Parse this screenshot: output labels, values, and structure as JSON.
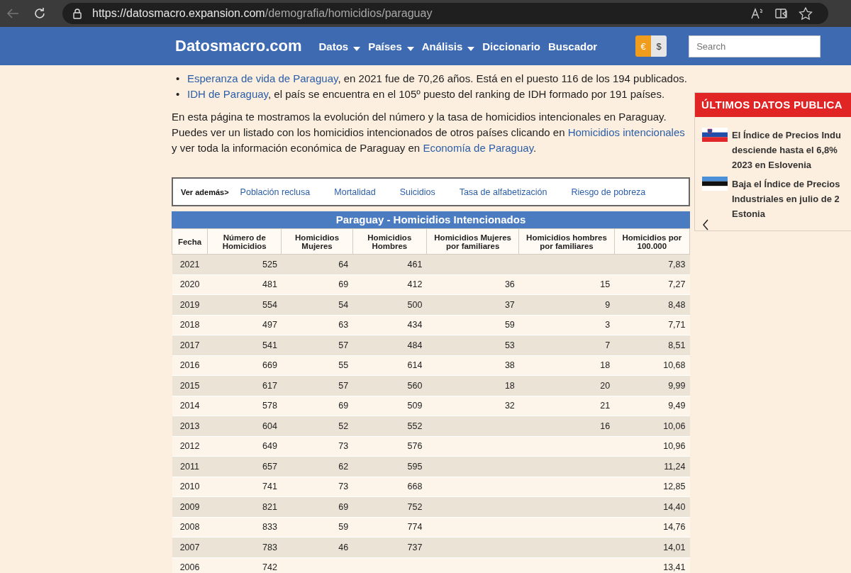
{
  "browser": {
    "url_host": "https://datosmacro.expansion.com",
    "url_path": "/demografia/homicidios/paraguay"
  },
  "header": {
    "logo": "Datosmacro.com",
    "nav": [
      {
        "label": "Datos",
        "dropdown": true
      },
      {
        "label": "Países",
        "dropdown": true
      },
      {
        "label": "Análisis",
        "dropdown": true
      },
      {
        "label": "Diccionario",
        "dropdown": false
      },
      {
        "label": "Buscador",
        "dropdown": false
      }
    ],
    "currency": [
      {
        "label": "€",
        "selected": true
      },
      {
        "label": "$",
        "selected": false
      }
    ],
    "search": {
      "placeholder": "Search"
    }
  },
  "bullets": [
    {
      "marker": "•",
      "link": "Esperanza de vida de Paraguay",
      "text": ", en 2021 fue de 70,26 años. Está en el puesto 116 de los 194 publicados."
    },
    {
      "marker": "•",
      "link": "IDH de Paraguay",
      "text": ", el país se encuentra en el 105º puesto del ranking de IDH formado por 191 países."
    }
  ],
  "intro": {
    "text1": "En esta página te mostramos la evolución del número y la tasa de homicidios intencionales en Paraguay. Puedes ver un listado con los homicidios intencionados de otros países clicando en ",
    "link1": "Homicidios intencionales",
    "text2": " y ver toda la información económica de Paraguay en ",
    "link2": "Economía de Paraguay",
    "text3": "."
  },
  "see_also": {
    "label": "Ver además>",
    "links": [
      "Población reclusa",
      "Mortalidad",
      "Suicidios",
      "Tasa de alfabetización",
      "Riesgo de pobreza"
    ]
  },
  "table": {
    "title": "Paraguay - Homicidios Intencionados",
    "columns": [
      "Fecha",
      "Número de Homicidios",
      "Homicidios Mujeres",
      "Homicidios Hombres",
      "Homicidios Mujeres por familiares",
      "Homicidios hombres por familiares",
      "Homicidios por 100.000"
    ],
    "rows": [
      {
        "fecha": "2021",
        "total": "525",
        "mujeres": "64",
        "hombres": "461",
        "tasa": "7,83"
      },
      {
        "fecha": "2020",
        "total": "481",
        "mujeres": "69",
        "hombres": "412",
        "mujeres_familiares": "36",
        "hombres_familiares": "15",
        "tasa": "7,27"
      },
      {
        "fecha": "2019",
        "total": "554",
        "mujeres": "54",
        "hombres": "500",
        "mujeres_familiares": "37",
        "hombres_familiares": "9",
        "tasa": "8,48"
      },
      {
        "fecha": "2018",
        "total": "497",
        "mujeres": "63",
        "hombres": "434",
        "mujeres_familiares": "59",
        "hombres_familiares": "3",
        "tasa": "7,71"
      },
      {
        "fecha": "2017",
        "total": "541",
        "mujeres": "57",
        "hombres": "484",
        "mujeres_familiares": "53",
        "hombres_familiares": "7",
        "tasa": "8,51"
      },
      {
        "fecha": "2016",
        "total": "669",
        "mujeres": "55",
        "hombres": "614",
        "mujeres_familiares": "38",
        "hombres_familiares": "18",
        "tasa": "10,68"
      },
      {
        "fecha": "2015",
        "total": "617",
        "mujeres": "57",
        "hombres": "560",
        "mujeres_familiares": "18",
        "hombres_familiares": "20",
        "tasa": "9,99"
      },
      {
        "fecha": "2014",
        "total": "578",
        "mujeres": "69",
        "hombres": "509",
        "mujeres_familiares": "32",
        "hombres_familiares": "21",
        "tasa": "9,49"
      },
      {
        "fecha": "2013",
        "total": "604",
        "mujeres": "52",
        "hombres": "552",
        "hombres_familiares": "16",
        "tasa": "10,06"
      },
      {
        "fecha": "2012",
        "total": "649",
        "mujeres": "73",
        "hombres": "576",
        "tasa": "10,96"
      },
      {
        "fecha": "2011",
        "total": "657",
        "mujeres": "62",
        "hombres": "595",
        "tasa": "11,24"
      },
      {
        "fecha": "2010",
        "total": "741",
        "mujeres": "73",
        "hombres": "668",
        "tasa": "12,85"
      },
      {
        "fecha": "2009",
        "total": "821",
        "mujeres": "69",
        "hombres": "752",
        "tasa": "14,40"
      },
      {
        "fecha": "2008",
        "total": "833",
        "mujeres": "59",
        "hombres": "774",
        "tasa": "14,76"
      },
      {
        "fecha": "2007",
        "total": "783",
        "mujeres": "46",
        "hombres": "737",
        "tasa": "14,01"
      },
      {
        "fecha": "2006",
        "total": "742",
        "tasa": "13,41"
      }
    ]
  },
  "latest": {
    "title": "ÚLTIMOS DATOS PUBLICA",
    "items": [
      {
        "kind": "slovenia",
        "lines": [
          "El Índice de Precios Indu",
          "desciende hasta el 6,8%",
          "2023 en Eslovenia"
        ]
      },
      {
        "kind": "estonia",
        "lines": [
          "Baja el Índice de Precios",
          "Industriales en julio de 2",
          "Estonia"
        ]
      }
    ]
  }
}
